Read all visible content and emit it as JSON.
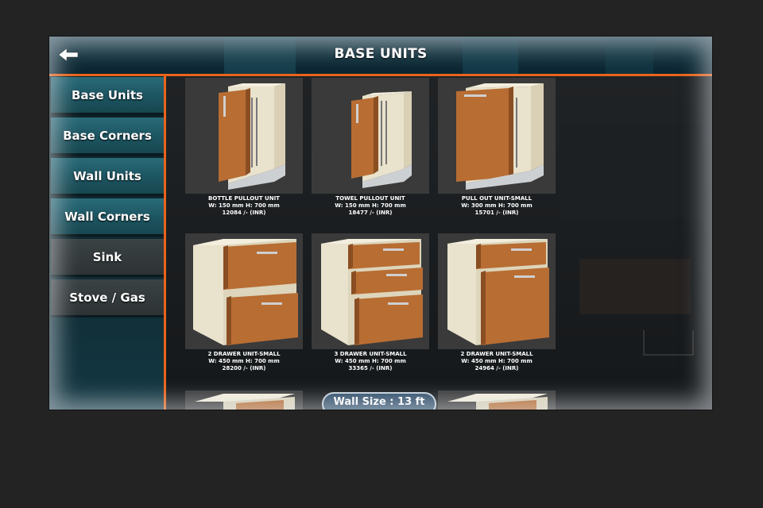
{
  "header": {
    "title": "BASE UNITS",
    "back_icon": "back-arrow-icon"
  },
  "sidebar": {
    "items": [
      {
        "label": "Base Units",
        "style": "teal"
      },
      {
        "label": "Base Corners",
        "style": "teal"
      },
      {
        "label": "Wall Units",
        "style": "teal"
      },
      {
        "label": "Wall Corners",
        "style": "teal"
      },
      {
        "label": "Sink",
        "style": "gray"
      },
      {
        "label": "Stove / Gas",
        "style": "gray"
      }
    ]
  },
  "products": [
    {
      "name": "BOTTLE PULLOUT UNIT",
      "dims": "W: 150 mm H: 700 mm",
      "price": "12084 /- (INR)",
      "icon": "pullout-cabinet-icon"
    },
    {
      "name": "TOWEL PULLOUT UNIT",
      "dims": "W: 150 mm H: 700 mm",
      "price": "18477 /- (INR)",
      "icon": "pullout-cabinet-icon"
    },
    {
      "name": "PULL OUT UNIT-SMALL",
      "dims": "W: 300 mm H: 700 mm",
      "price": "15701 /- (INR)",
      "icon": "pullout-cabinet-icon"
    },
    {
      "name": "2 DRAWER UNIT-SMALL",
      "dims": "W: 450 mm H: 700 mm",
      "price": "28200 /- (INR)",
      "icon": "drawer-cabinet-icon"
    },
    {
      "name": "3 DRAWER UNIT-SMALL",
      "dims": "W: 450 mm H: 700 mm",
      "price": "33365 /- (INR)",
      "icon": "drawer-cabinet-icon"
    },
    {
      "name": "2 DRAWER UNIT-SMALL",
      "dims": "W: 450 mm H: 700 mm",
      "price": "24964 /- (INR)",
      "icon": "drawer-cabinet-icon"
    }
  ],
  "wall_size": {
    "label": "Wall Size : 13 ft"
  },
  "colors": {
    "accent_orange": "#e8641c",
    "cabinet_wood": "#b86d33",
    "cabinet_body": "#e9e2cc",
    "header_teal": "#163c4a"
  }
}
